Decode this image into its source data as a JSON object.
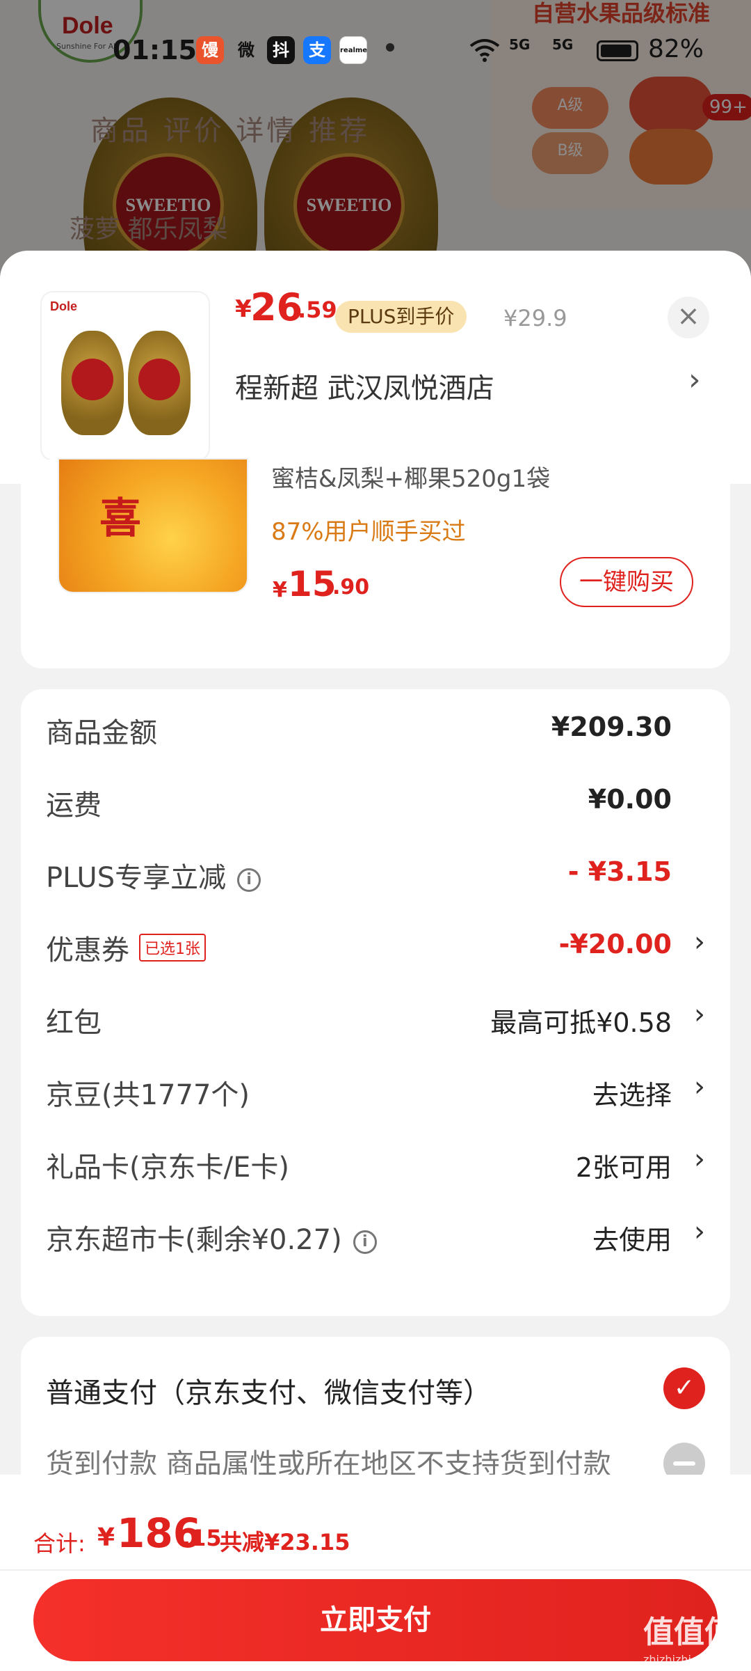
{
  "status_bar": {
    "time": "01:15",
    "battery": "82%",
    "net1": "5G",
    "net2": "5G",
    "app_icons": [
      "馒",
      "微",
      "抖",
      "支",
      "realme"
    ]
  },
  "background": {
    "brand": "Dole",
    "brand_tagline": "Sunshine For All",
    "product_label": "SWEETIO",
    "tabs": "商品  评价  详情  推荐",
    "tab_row2": "菠萝     都乐凤梨",
    "grade_title": "自营水果品级标准",
    "grade_a": "A级",
    "grade_b": "B级",
    "badge": "99+"
  },
  "product": {
    "thumb_brand": "Dole",
    "price_currency": "¥",
    "price_int": "26",
    "price_dec": ".59",
    "plus_tag": "PLUS到手价",
    "original_price": "¥29.9",
    "address": "程新超 武汉凤悦酒店",
    "close_icon": "×",
    "chevron": "›"
  },
  "recommend": {
    "name": "蜜桔&凤梨+椰果520g1袋",
    "bought": "87%用户顺手买过",
    "price_currency": "¥",
    "price_int": "15",
    "price_dec": ".90",
    "buy_label": "一键购买",
    "img_text": "喜"
  },
  "summary": {
    "rows": [
      {
        "label": "商品金额",
        "value": "¥209.30"
      },
      {
        "label": "运费",
        "value": "¥0.00"
      },
      {
        "label": "PLUS专享立减",
        "value": "- ¥3.15"
      },
      {
        "label": "优惠券",
        "tag": "已选1张",
        "value": "-¥20.00"
      },
      {
        "label": "红包",
        "value": "最高可抵¥0.58"
      },
      {
        "label": "京豆(共1777个)",
        "value": "去选择"
      },
      {
        "label": "礼品卡(京东卡/E卡)",
        "value": "2张可用"
      },
      {
        "label": "京东超市卡(剩余¥0.27)",
        "value": "去使用"
      }
    ],
    "info_icon": "i",
    "chevron": "›"
  },
  "payment": {
    "option_normal": "普通支付（京东支付、微信支付等）",
    "option_cod": "货到付款 商品属性或所在地区不支持货到付款",
    "check": "✓"
  },
  "footer": {
    "total_label": "合计:",
    "total_currency": "¥",
    "total_int": "186",
    "total_dec": ".15",
    "total_saved": "共减¥23.15",
    "pay_button": "立即支付",
    "watermark": "值值值",
    "watermark_url": "zhizhizhi.com"
  },
  "colors": {
    "accent": "#e0221e",
    "orange": "#d97a14",
    "plus_tag_bg": "#f9e3b0"
  }
}
